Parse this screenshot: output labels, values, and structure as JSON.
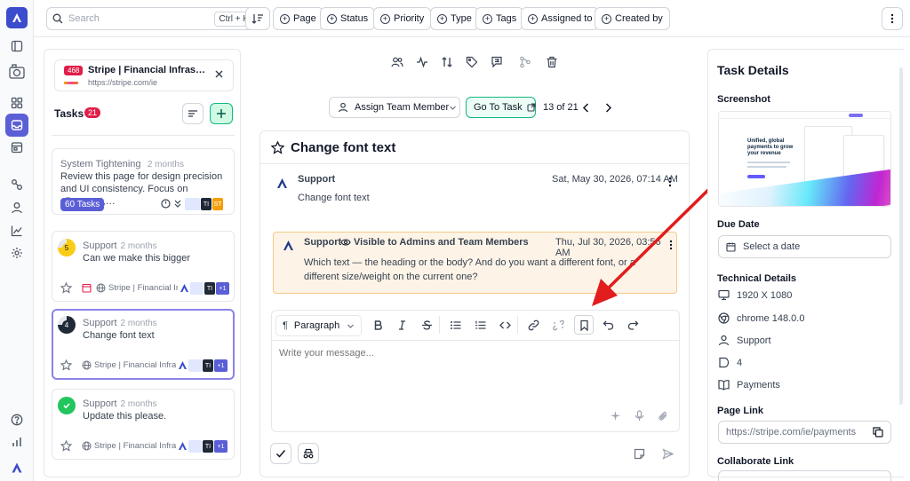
{
  "topbar": {
    "search_placeholder": "Search",
    "search_shortcut": "Ctrl + K",
    "filters": [
      "Page",
      "Status",
      "Priority",
      "Type",
      "Tags",
      "Assigned to",
      "Created by"
    ]
  },
  "tasks_panel": {
    "site_count": "468",
    "site_title": "Stripe | Financial Infras…",
    "site_url": "https://stripe.com/ie",
    "tasks_label": "Tasks",
    "tasks_count": "21",
    "group_card": {
      "title": "System Tightening",
      "time": "2 months",
      "body": "Review this page for design precision and UI consistency. Focus on alignment,…",
      "badge": "60 Tasks",
      "avatars": [
        "TI",
        "ST"
      ]
    },
    "cards": [
      {
        "number": "5",
        "author": "Support",
        "time": "2 months",
        "text": "Can we make this bigger",
        "site": "Stripe | Financial Infra…",
        "extra": "+1",
        "avatar": "TI"
      },
      {
        "number": "4",
        "author": "Support",
        "time": "2 months",
        "text": "Change font text",
        "site": "Stripe | Financial Infra…",
        "extra": "+1",
        "avatar": "TI"
      },
      {
        "number": "",
        "author": "Support",
        "time": "2 months",
        "text": "Update this please.",
        "site": "Stripe | Financial Infra…",
        "extra": "+1",
        "avatar": "TI"
      }
    ]
  },
  "center": {
    "assign_label": "Assign Team Member",
    "goto_label": "Go To Task",
    "pagination": "13 of 21",
    "task_title": "Change font text",
    "messages": [
      {
        "author": "Support",
        "date": "Sat, May 30, 2026, 07:14 AM",
        "text": "Change font text"
      },
      {
        "author": "Support",
        "visibility": "Visible to Admins and Team Members",
        "date": "Thu, Jul 30, 2026, 03:56 AM",
        "text": "Which text — the heading or the body? And do you want a different font, or a different size/weight on the current one?"
      }
    ],
    "editor": {
      "block_type": "Paragraph",
      "placeholder": "Write your message..."
    }
  },
  "details": {
    "heading": "Task Details",
    "screenshot_label": "Screenshot",
    "screenshot_headline": "Unified, global payments to grow your revenue",
    "due_date_label": "Due Date",
    "due_date_value": "Select a date",
    "technical_label": "Technical Details",
    "resolution": "1920 X 1080",
    "browser": "chrome 148.0.0",
    "user": "Support",
    "tag_count": "4",
    "page_name": "Payments",
    "page_link_label": "Page Link",
    "page_link": "https://stripe.com/ie/payments",
    "collab_label": "Collaborate Link"
  },
  "colors": {
    "accent": "#5b5fd6",
    "brand": "#3b4ccc",
    "danger": "#e11d48",
    "annotation_arrow": "#e11d1d",
    "highlight_bg": "#fdf4e7",
    "highlight_border": "#f5c98b",
    "success": "#10b981"
  }
}
